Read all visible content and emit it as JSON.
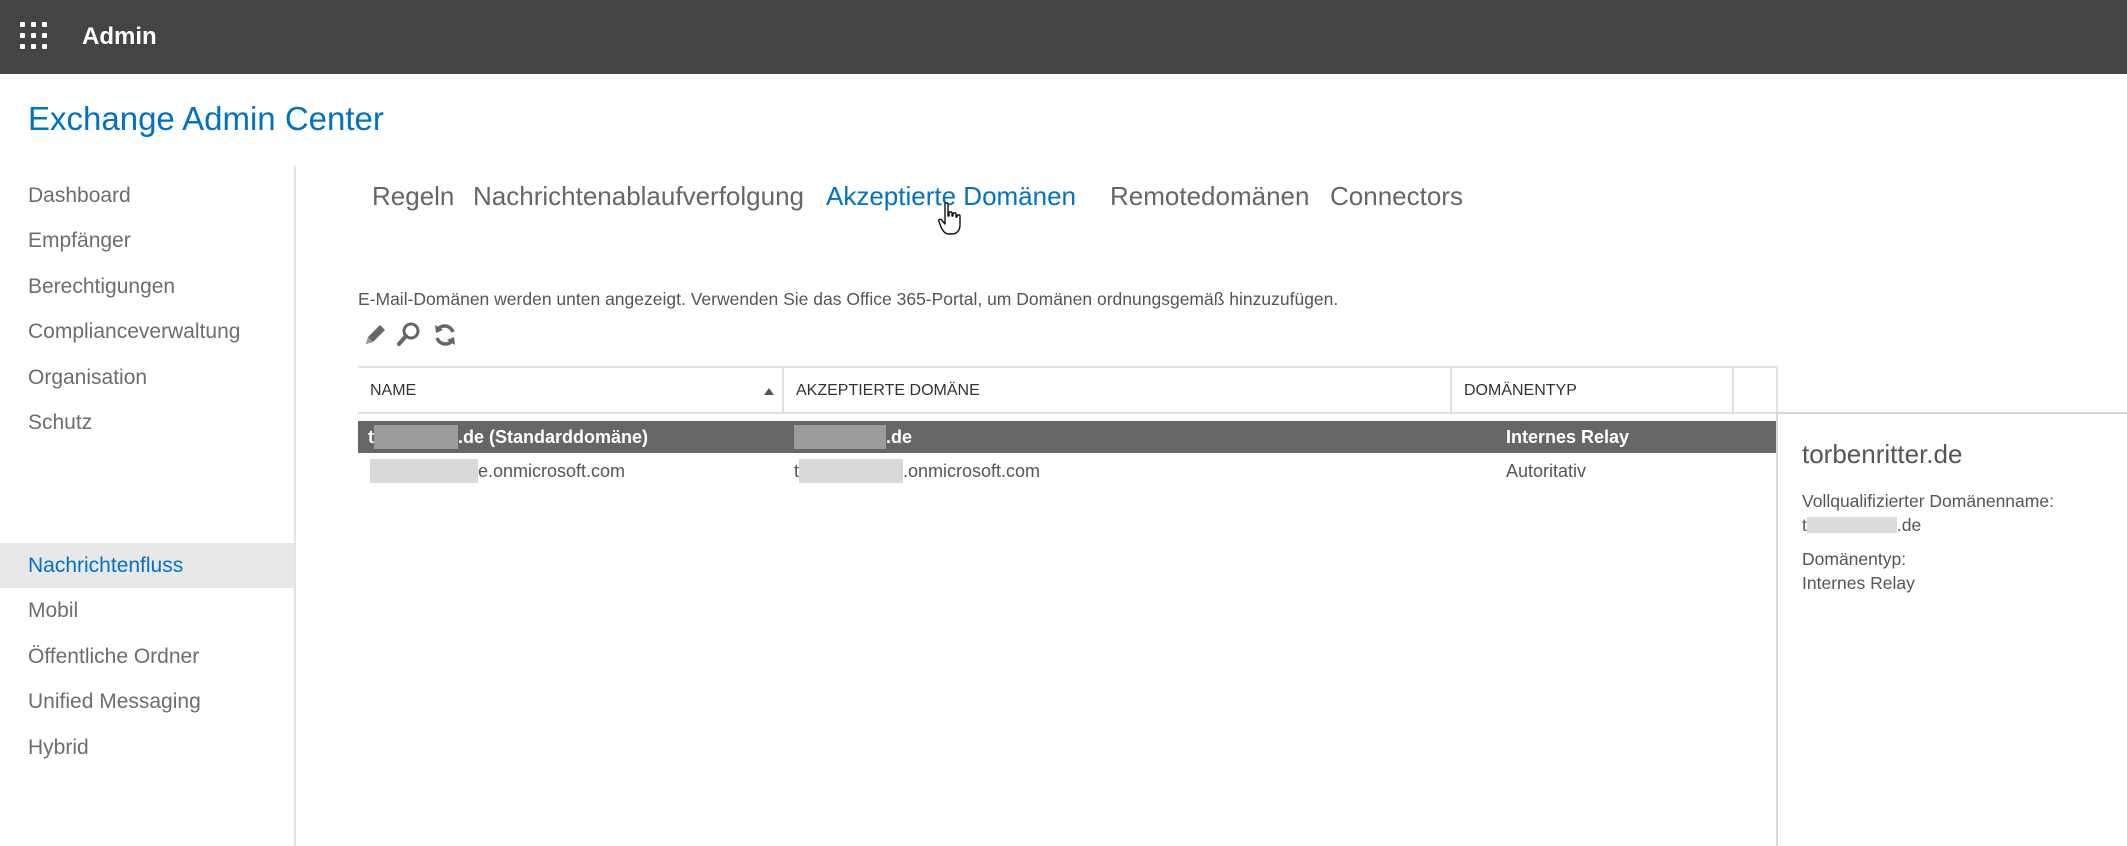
{
  "topbar": {
    "app_name": "Admin",
    "launcher_icon": "waffle-grid-icon"
  },
  "header": {
    "title": "Exchange Admin Center"
  },
  "sidebar": {
    "items": [
      {
        "label": "Dashboard"
      },
      {
        "label": "Empfänger"
      },
      {
        "label": "Berechtigungen"
      },
      {
        "label": "Complianceverwaltung"
      },
      {
        "label": "Organisation"
      },
      {
        "label": "Schutz"
      },
      {
        "label": "Nachrichtenfluss",
        "active": true
      },
      {
        "label": "Mobil"
      },
      {
        "label": "Öffentliche Ordner"
      },
      {
        "label": "Unified Messaging"
      },
      {
        "label": "Hybrid"
      }
    ]
  },
  "tabs": [
    {
      "label": "Regeln"
    },
    {
      "label": "Nachrichtenablaufverfolgung"
    },
    {
      "label": "Akzeptierte Domänen",
      "active": true
    },
    {
      "label": "Remotedomänen"
    },
    {
      "label": "Connectors"
    }
  ],
  "main": {
    "description": "E-Mail-Domänen werden unten angezeigt. Verwenden Sie das Office 365-Portal, um Domänen ordnungsgemäß hinzuzufügen.",
    "toolbar": {
      "edit_icon": "pencil-icon",
      "search_icon": "search-icon",
      "refresh_icon": "refresh-icon"
    },
    "table": {
      "columns": [
        "NAME",
        "AKZEPTIERTE DOMÄNE",
        "DOMÄNENTYP"
      ],
      "sort_column": "NAME",
      "sort_direction": "ascending",
      "rows": [
        {
          "name_prefix": "t",
          "name_suffix": ".de (Standarddomäne)",
          "domain_suffix": ".de",
          "type": "Internes Relay",
          "selected": true
        },
        {
          "name_prefix": "",
          "name_suffix": "e.onmicrosoft.com",
          "domain_prefix": "t",
          "domain_suffix": ".onmicrosoft.com",
          "type": "Autoritativ",
          "selected": false
        }
      ]
    }
  },
  "details": {
    "title": "torbenritter.de",
    "fqdn_label": "Vollqualifizierter Domänenname:",
    "fqdn_prefix": "t",
    "fqdn_suffix": ".de",
    "type_label": "Domänentyp:",
    "type_value": "Internes Relay"
  },
  "colors": {
    "topbar": "#444444",
    "accent": "#0072c6",
    "selected_row": "#666666",
    "active_nav_bg": "#e8e8e8"
  }
}
